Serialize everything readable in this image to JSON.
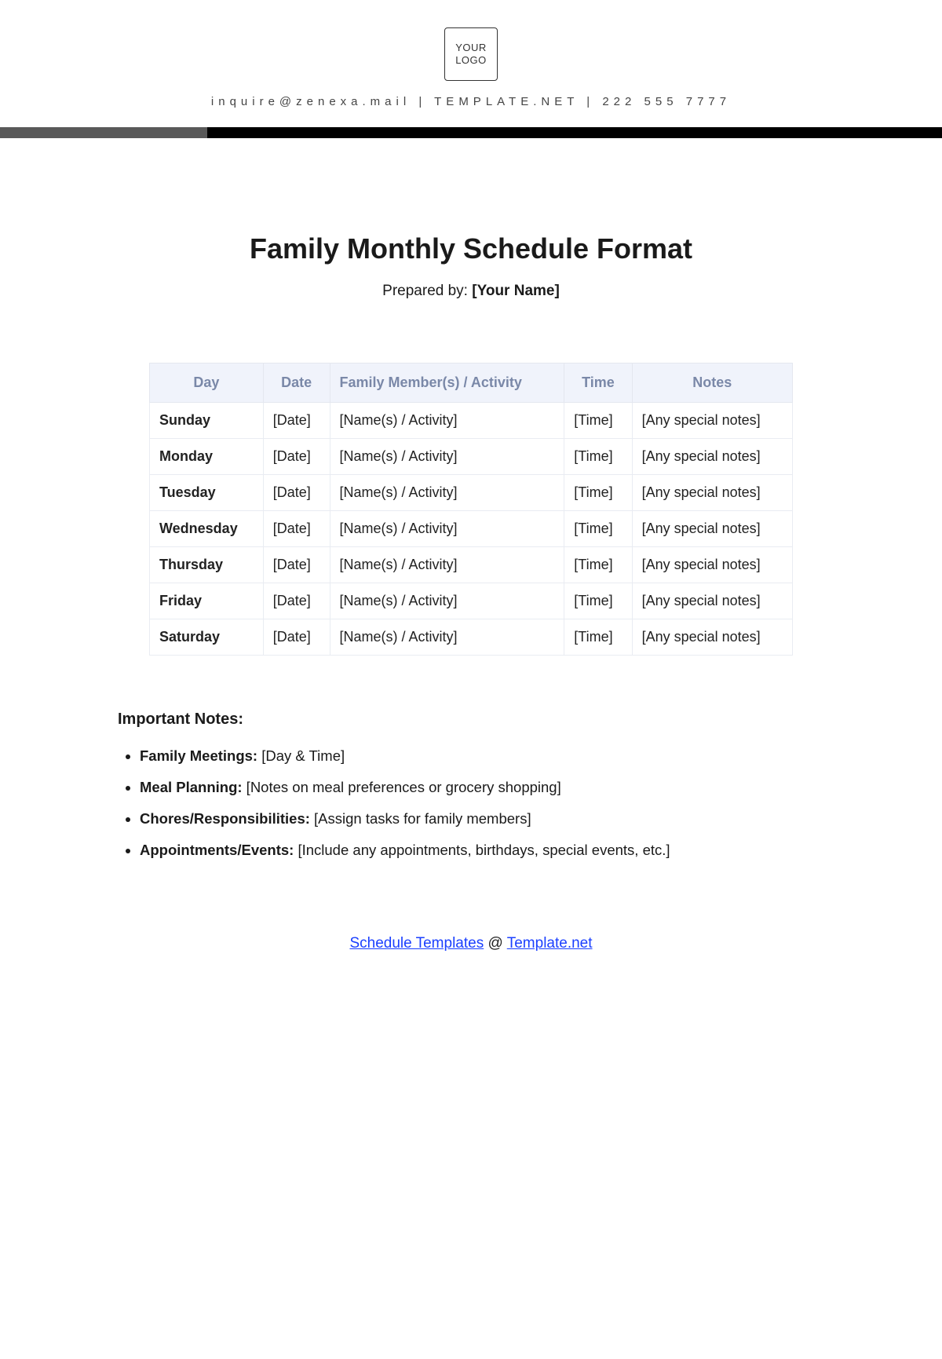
{
  "header": {
    "logo_line1": "YOUR",
    "logo_line2": "LOGO",
    "info_text": "inquire@zenexa.mail | TEMPLATE.NET | 222 555 7777"
  },
  "title": "Family Monthly Schedule Format",
  "prepared_by_label": "Prepared by: ",
  "prepared_by_value": "[Your Name]",
  "table": {
    "headers": [
      "Day",
      "Date",
      "Family Member(s) / Activity",
      "Time",
      "Notes"
    ],
    "rows": [
      {
        "day": "Sunday",
        "date": "[Date]",
        "activity": "[Name(s) / Activity]",
        "time": "[Time]",
        "notes": "[Any special notes]"
      },
      {
        "day": "Monday",
        "date": "[Date]",
        "activity": "[Name(s) / Activity]",
        "time": "[Time]",
        "notes": "[Any special notes]"
      },
      {
        "day": "Tuesday",
        "date": "[Date]",
        "activity": "[Name(s) / Activity]",
        "time": "[Time]",
        "notes": "[Any special notes]"
      },
      {
        "day": "Wednesday",
        "date": "[Date]",
        "activity": "[Name(s) / Activity]",
        "time": "[Time]",
        "notes": "[Any special notes]"
      },
      {
        "day": "Thursday",
        "date": "[Date]",
        "activity": "[Name(s) / Activity]",
        "time": "[Time]",
        "notes": "[Any special notes]"
      },
      {
        "day": "Friday",
        "date": "[Date]",
        "activity": "[Name(s) / Activity]",
        "time": "[Time]",
        "notes": "[Any special notes]"
      },
      {
        "day": "Saturday",
        "date": "[Date]",
        "activity": "[Name(s) / Activity]",
        "time": "[Time]",
        "notes": "[Any special notes]"
      }
    ]
  },
  "notes_heading": "Important Notes:",
  "notes": [
    {
      "key": "Family Meetings:",
      "val": " [Day & Time]"
    },
    {
      "key": "Meal Planning:",
      "val": " [Notes on meal preferences or grocery shopping]"
    },
    {
      "key": "Chores/Responsibilities:",
      "val": " [Assign tasks for family members]"
    },
    {
      "key": "Appointments/Events:",
      "val": " [Include any appointments, birthdays, special events, etc.]"
    }
  ],
  "footer": {
    "link1_text": "Schedule Templates",
    "at_text": " @ ",
    "link2_text": "Template.net"
  }
}
